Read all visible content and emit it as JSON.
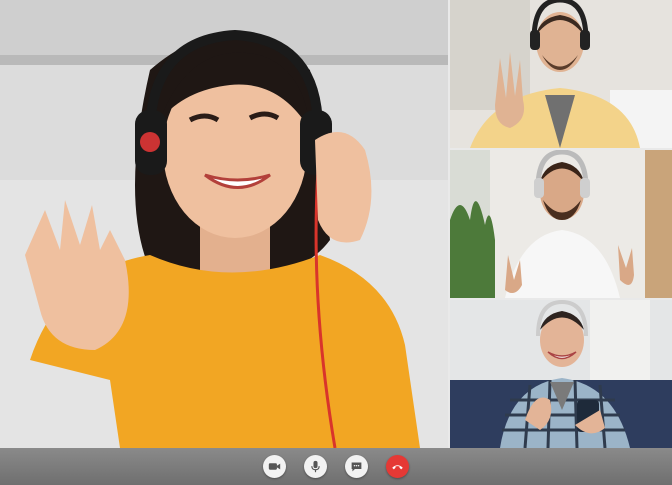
{
  "app": {
    "participant_count": 4
  },
  "controls": [
    {
      "icon": "video-camera-icon",
      "color": "#555555"
    },
    {
      "icon": "microphone-icon",
      "color": "#555555"
    },
    {
      "icon": "chat-icon",
      "color": "#555555"
    },
    {
      "icon": "end-call-icon",
      "color": "#e53935"
    }
  ],
  "colors": {
    "control_bar": "#7b7b7b",
    "end_call": "#e53935",
    "shirt_yellow": "#f2a623"
  }
}
